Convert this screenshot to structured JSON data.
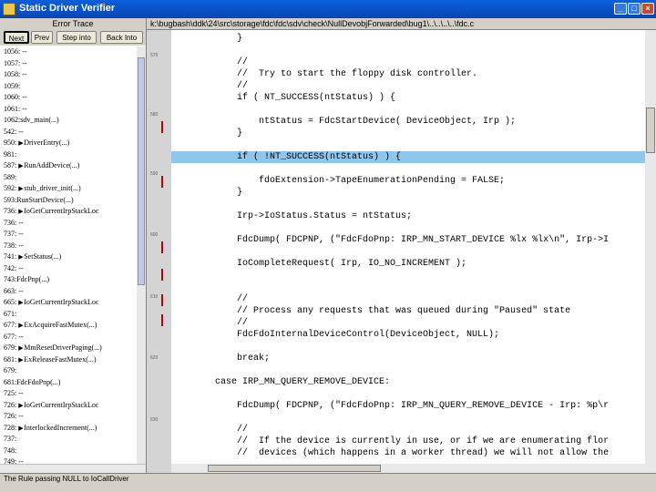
{
  "window": {
    "title": "Static Driver Verifier"
  },
  "trace": {
    "header": "Error Trace",
    "toolbar": [
      "Next",
      "Prev",
      "Step into",
      "Back Into"
    ],
    "rows": [
      {
        "text": "1056: --",
        "arrow": false
      },
      {
        "text": "1057: --",
        "arrow": false
      },
      {
        "text": "1058: --",
        "arrow": false
      },
      {
        "text": "1059:",
        "arrow": false
      },
      {
        "text": "1060: --",
        "arrow": false
      },
      {
        "text": "1061: --",
        "arrow": false
      },
      {
        "text": "1062:sdv_main(...)",
        "arrow": false
      },
      {
        "text": "542: --",
        "arrow": false
      },
      {
        "text": "950: ",
        "arrow": true,
        "call": "DriverEntry(...)"
      },
      {
        "text": "981:",
        "arrow": false
      },
      {
        "text": "587: ",
        "arrow": true,
        "call": "RunAddDevice(...)"
      },
      {
        "text": "589:",
        "arrow": false
      },
      {
        "text": "592: ",
        "arrow": true,
        "call": "stub_driver_init(...)"
      },
      {
        "text": "593:RunStartDevice(...)",
        "arrow": false
      },
      {
        "text": "736: ",
        "arrow": true,
        "call": "IoGetCurrentIrpStackLoc"
      },
      {
        "text": "736: --",
        "arrow": false
      },
      {
        "text": "737: --",
        "arrow": false
      },
      {
        "text": "738: --",
        "arrow": false
      },
      {
        "text": "741: ",
        "arrow": true,
        "call": "SetStatus(...)"
      },
      {
        "text": "742: --",
        "arrow": false
      },
      {
        "text": "743:FdcPnp(...)",
        "arrow": false
      },
      {
        "text": "663: --",
        "arrow": false
      },
      {
        "text": "665: ",
        "arrow": true,
        "call": "IoGetCurrentIrpStackLoc"
      },
      {
        "text": "671:",
        "arrow": false
      },
      {
        "text": "677: ",
        "arrow": true,
        "call": "ExAcquireFastMutex(...)"
      },
      {
        "text": "677: --",
        "arrow": false
      },
      {
        "text": "679: ",
        "arrow": true,
        "call": "MmResetDriverPaging(...)"
      },
      {
        "text": "681: ",
        "arrow": true,
        "call": "ExReleaseFastMutex(...)"
      },
      {
        "text": "679:",
        "arrow": false
      },
      {
        "text": "681:FdcFdoPnp(...)",
        "arrow": false
      },
      {
        "text": "725: --",
        "arrow": false
      },
      {
        "text": "726: ",
        "arrow": true,
        "call": "IoGetCurrentIrpStackLoc"
      },
      {
        "text": "726: --",
        "arrow": false
      },
      {
        "text": "728: ",
        "arrow": true,
        "call": "InterlockedIncrement(...)"
      },
      {
        "text": "737:",
        "arrow": false
      },
      {
        "text": "748:",
        "arrow": false
      },
      {
        "text": "749: --",
        "arrow": false
      },
      {
        "text": "750: --",
        "arrow": false
      }
    ]
  },
  "path": "k:\\bugbash\\ddk\\24\\src\\storage\\fdc\\fdc\\sdv\\check\\NullDevobjForwarded\\bug1\\..\\..\\..\\..\\fdc.c",
  "gutter_marks": [
    "570",
    "580",
    "590",
    "600",
    "610",
    "620",
    "630"
  ],
  "code_lines": [
    {
      "text": "            }",
      "hl": false
    },
    {
      "text": "",
      "hl": false
    },
    {
      "text": "            //",
      "hl": false
    },
    {
      "text": "            //  Try to start the floppy disk controller.",
      "hl": false
    },
    {
      "text": "            //",
      "hl": false
    },
    {
      "text": "            if ( NT_SUCCESS(ntStatus) ) {",
      "hl": false
    },
    {
      "text": "",
      "hl": false
    },
    {
      "text": "                ntStatus = FdcStartDevice( DeviceObject, Irp );",
      "hl": false
    },
    {
      "text": "            }",
      "hl": false
    },
    {
      "text": "",
      "hl": false
    },
    {
      "text": "            if ( !NT_SUCCESS(ntStatus) ) {",
      "hl": true
    },
    {
      "text": "",
      "hl": false
    },
    {
      "text": "                fdoExtension->TapeEnumerationPending = FALSE;",
      "hl": false
    },
    {
      "text": "            }",
      "hl": false
    },
    {
      "text": "",
      "hl": false
    },
    {
      "text": "            Irp->IoStatus.Status = ntStatus;",
      "hl": false
    },
    {
      "text": "",
      "hl": false
    },
    {
      "text": "            FdcDump( FDCPNP, (\"FdcFdoPnp: IRP_MN_START_DEVICE %lx %lx\\n\", Irp->I",
      "hl": false
    },
    {
      "text": "",
      "hl": false
    },
    {
      "text": "            IoCompleteRequest( Irp, IO_NO_INCREMENT );",
      "hl": false
    },
    {
      "text": "",
      "hl": false
    },
    {
      "text": "",
      "hl": false
    },
    {
      "text": "            //",
      "hl": false
    },
    {
      "text": "            // Process any requests that was queued during \"Paused\" state",
      "hl": false
    },
    {
      "text": "            //",
      "hl": false
    },
    {
      "text": "            FdcFdoInternalDeviceControl(DeviceObject, NULL);",
      "hl": false
    },
    {
      "text": "",
      "hl": false
    },
    {
      "text": "            break;",
      "hl": false
    },
    {
      "text": "",
      "hl": false
    },
    {
      "text": "        case IRP_MN_QUERY_REMOVE_DEVICE:",
      "hl": false
    },
    {
      "text": "",
      "hl": false
    },
    {
      "text": "            FdcDump( FDCPNP, (\"FdcFdoPnp: IRP_MN_QUERY_REMOVE_DEVICE - Irp: %p\\r",
      "hl": false
    },
    {
      "text": "",
      "hl": false
    },
    {
      "text": "            //",
      "hl": false
    },
    {
      "text": "            //  If the device is currently in use, or if we are enumerating flor",
      "hl": false
    },
    {
      "text": "            //  devices (which happens in a worker thread) we will not allow the",
      "hl": false
    }
  ],
  "status": "The Rule passing NULL to IoCallDriver"
}
